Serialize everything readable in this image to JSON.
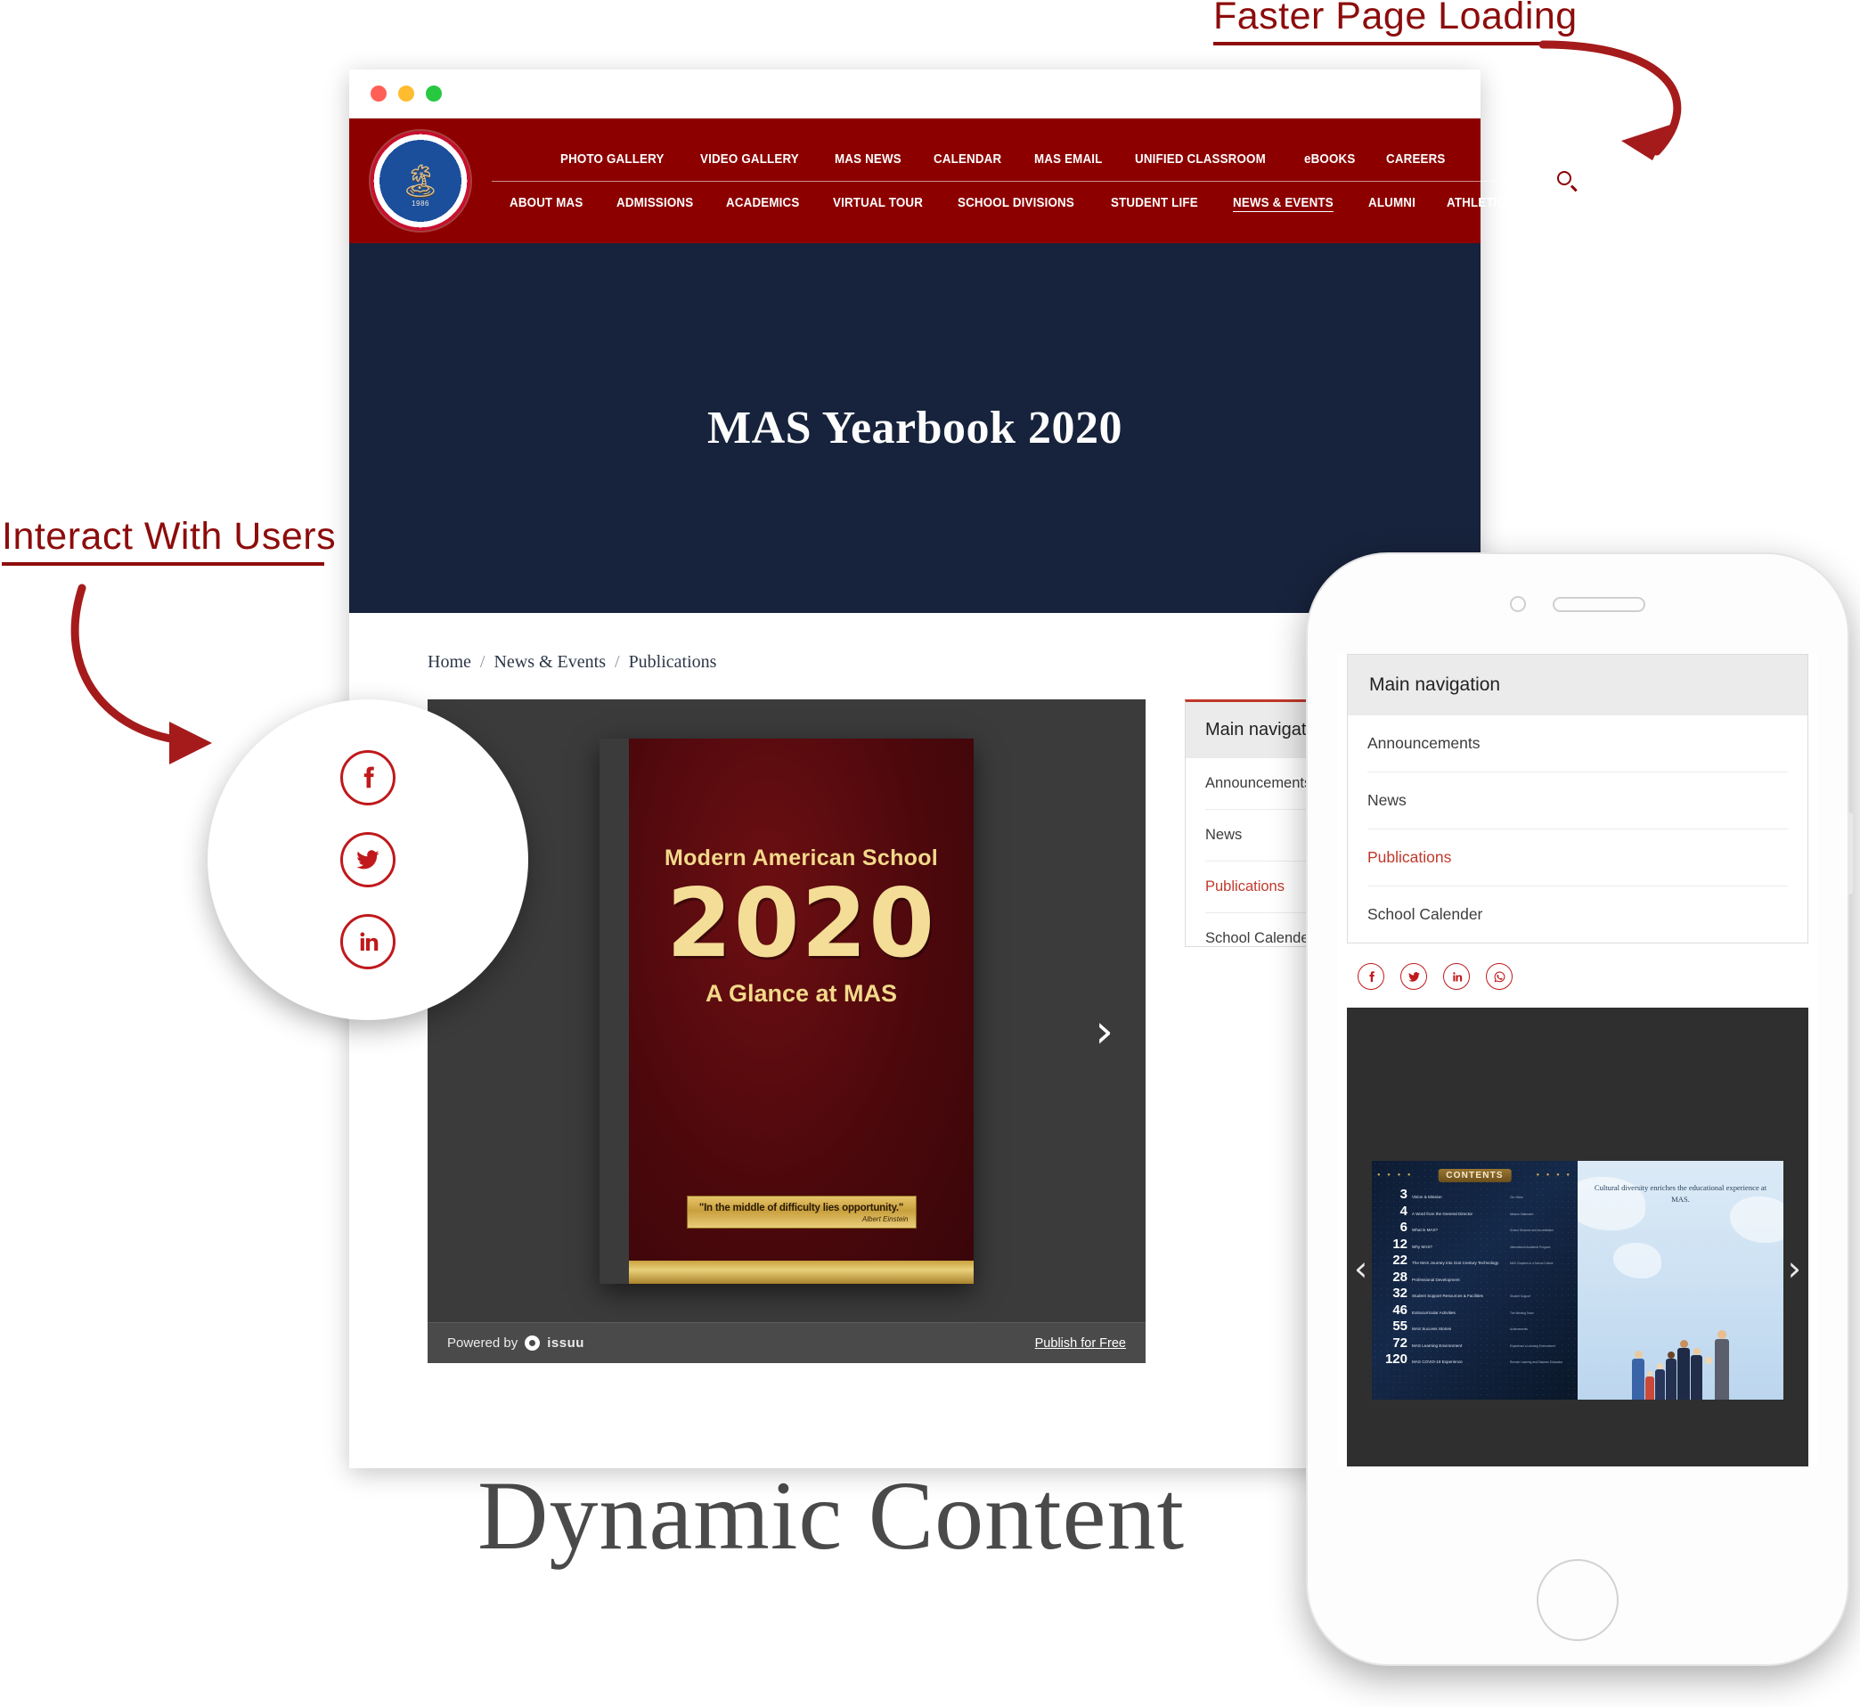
{
  "annotations": {
    "faster_page_loading": "Faster Page Loading",
    "interact_with_users": "Interact With Users",
    "dynamic_content": "Dynamic Content"
  },
  "colors": {
    "brand_red": "#8d0000",
    "accent_red": "#c0392b",
    "social_red": "#c0191c",
    "hero_navy": "#17233c",
    "annotation_red": "#8d0c0c",
    "dynamic_gray": "#4a4a4a",
    "viewer_gray": "#3b3b3b"
  },
  "browser": {
    "traffic_lights": [
      "close-red",
      "minimize-yellow",
      "maximize-green"
    ]
  },
  "site_header": {
    "logo_alt": "Modern American School seal",
    "logo_year": "1986",
    "top_nav": [
      "PHOTO GALLERY",
      "VIDEO GALLERY",
      "MAS NEWS",
      "CALENDAR",
      "MAS EMAIL",
      "UNIFIED CLASSROOM",
      "eBOOKS",
      "CAREERS"
    ],
    "main_nav": [
      {
        "label": "ABOUT MAS",
        "active": false
      },
      {
        "label": "ADMISSIONS",
        "active": false
      },
      {
        "label": "ACADEMICS",
        "active": false
      },
      {
        "label": "VIRTUAL TOUR",
        "active": false
      },
      {
        "label": "SCHOOL DIVISIONS",
        "active": false
      },
      {
        "label": "STUDENT LIFE",
        "active": false
      },
      {
        "label": "NEWS & EVENTS",
        "active": true
      },
      {
        "label": "ALUMNI",
        "active": false
      },
      {
        "label": "ATHLETICS",
        "active": false
      }
    ],
    "search_icon": "search-icon"
  },
  "hero": {
    "title": "MAS Yearbook 2020"
  },
  "breadcrumb": {
    "items": [
      "Home",
      "News & Events",
      "Publications"
    ],
    "separator": "/"
  },
  "issuu_viewer": {
    "book": {
      "school": "Modern American School",
      "year": "2020",
      "subtitle": "A Glance at MAS",
      "quote": "\"In the middle of difficulty lies opportunity.\"",
      "quote_author": "Albert Einstein"
    },
    "next_arrow": "›",
    "powered_by": "Powered by",
    "brand": "issuu",
    "publish_link": "Publish for Free"
  },
  "desktop_sidebar": {
    "header": "Main navigation",
    "items": [
      {
        "label": "Announcements",
        "active": false
      },
      {
        "label": "News",
        "active": false
      },
      {
        "label": "Publications",
        "active": true
      },
      {
        "label": "School Calender",
        "active": false
      }
    ]
  },
  "social_bubble": {
    "icons": [
      "facebook-icon",
      "twitter-icon",
      "linkedin-icon"
    ]
  },
  "phone": {
    "sidebar": {
      "header": "Main navigation",
      "items": [
        {
          "label": "Announcements",
          "active": false
        },
        {
          "label": "News",
          "active": false
        },
        {
          "label": "Publications",
          "active": true
        },
        {
          "label": "School Calender",
          "active": false
        }
      ]
    },
    "social_icons": [
      "facebook-icon",
      "twitter-icon",
      "linkedin-icon",
      "whatsapp-icon"
    ],
    "viewer": {
      "prev_arrow": "‹",
      "next_arrow": "›",
      "contents_title": "CONTENTS",
      "toc": [
        {
          "num": "3",
          "title": "Vision & Mission",
          "sub": "Our Vision"
        },
        {
          "num": "4",
          "title": "A Word from the General Director",
          "sub": "Mission Statement"
        },
        {
          "num": "6",
          "title": "What is MAS?",
          "sub": "School Structure and Accreditation"
        },
        {
          "num": "12",
          "title": "Why MAS?",
          "sub": "International Academic Program"
        },
        {
          "num": "22",
          "title": "The MAS Journey into 21st Century Technology",
          "sub": "MAS Chapters in a School Culture"
        },
        {
          "num": "28",
          "title": "Professional Development",
          "sub": ""
        },
        {
          "num": "32",
          "title": "Student Support Resources & Facilities",
          "sub": "Student Support"
        },
        {
          "num": "46",
          "title": "Extracurricular Activities",
          "sub": "The Winning Team"
        },
        {
          "num": "55",
          "title": "MAS Success Stories",
          "sub": "Achievements"
        },
        {
          "num": "72",
          "title": "MAS Learning Environment",
          "sub": "Experience a Learning Environment"
        },
        {
          "num": "120",
          "title": "MAS COVID-19 Experience",
          "sub": "Remote Learning and Distance Education"
        }
      ],
      "right_page_text": "Cultural diversity enriches the educational experience at MAS."
    }
  }
}
